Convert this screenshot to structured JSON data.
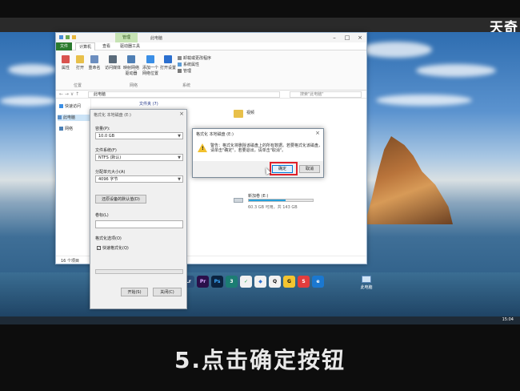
{
  "brand": "天奇",
  "caption": "5.点击确定按钮",
  "explorer": {
    "context_tab": "管理",
    "title": "此电脑",
    "tabs": [
      "文件",
      "计算机",
      "查看",
      "驱动器工具"
    ],
    "ribbon": {
      "properties": "属性",
      "open": "打开",
      "rename": "重命名",
      "access_media": "访问媒体",
      "map_drive": "映射网络驱动器",
      "add_location": "添加一个网络位置",
      "open_settings": "打开设置",
      "uninstall": "卸载或更改程序",
      "system_props": "系统属性",
      "manage": "管理",
      "group_location": "位置",
      "group_network": "网络",
      "group_system": "系统"
    },
    "address": "此电脑",
    "search_placeholder": "搜索\"此电脑\"",
    "nav": [
      "快速访问",
      "此电脑",
      "网络"
    ],
    "group_header": "文件夹 (7)",
    "folder_video": "视频",
    "drive": {
      "name": "新加卷 (E:)",
      "free": "60.3 GB 可用，共 143 GB",
      "used_percent": 58
    },
    "status": "16 个项目",
    "colors": {
      "file_tab": "#2a7a2e",
      "context_tab": "#c6e3b4",
      "drive_bar": "#26a0da"
    }
  },
  "format_dialog": {
    "title": "格式化 本地磁盘 (E:)",
    "capacity_label": "容量(P):",
    "capacity_value": "10.0 GB",
    "fs_label": "文件系统(F)",
    "fs_value": "NTFS (默认)",
    "alloc_label": "分配单元大小(A)",
    "alloc_value": "4096 字节",
    "restore_button": "还原设备的默认值(D)",
    "volume_label": "卷标(L)",
    "options_label": "格式化选项(O)",
    "quick_format": "快速格式化(Q)",
    "start_button": "开始(S)",
    "close_button": "关闭(C)"
  },
  "warning_dialog": {
    "title": "格式化 本地磁盘 (E:)",
    "message": "警告：格式化将删除该磁盘上的所有数据。若要格式化该磁盘，请单击\"确定\"。若要退出，请单击\"取消\"。",
    "ok": "确定",
    "cancel": "取消"
  },
  "dock_apps": [
    "Lr",
    "Pr",
    "Ps",
    "3",
    "✓",
    "◆",
    "Q",
    "G",
    "S",
    "e"
  ],
  "desktop_icon": "此电脑",
  "clock": "15:04"
}
